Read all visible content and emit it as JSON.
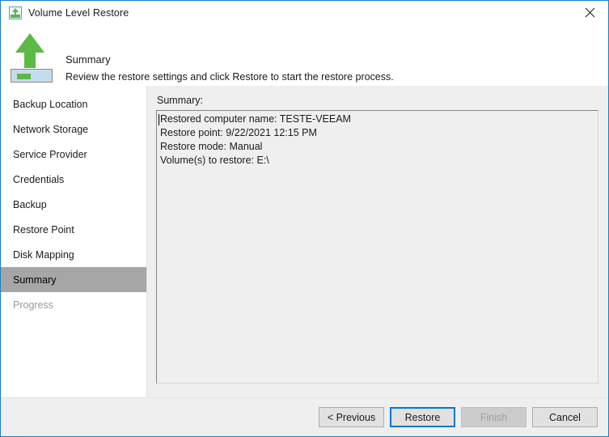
{
  "window": {
    "title": "Volume Level Restore",
    "title_icon": "volume-restore-icon",
    "close_icon": "close-icon",
    "accent_border_color": "#1a7ec2"
  },
  "header": {
    "icon": "green-up-arrow-volume-icon",
    "title": "Summary",
    "subtitle": "Review the restore settings and click Restore to start the restore process."
  },
  "sidebar": {
    "items": [
      {
        "label": "Backup Location",
        "state": "normal"
      },
      {
        "label": "Network Storage",
        "state": "normal"
      },
      {
        "label": "Service Provider",
        "state": "normal"
      },
      {
        "label": "Credentials",
        "state": "normal"
      },
      {
        "label": "Backup",
        "state": "normal"
      },
      {
        "label": "Restore Point",
        "state": "normal"
      },
      {
        "label": "Disk Mapping",
        "state": "normal"
      },
      {
        "label": "Summary",
        "state": "selected"
      },
      {
        "label": "Progress",
        "state": "disabled"
      }
    ],
    "selected_background": "#a6a6a6"
  },
  "content": {
    "summary_label": "Summary:",
    "summary_text": "Restored computer name: TESTE-VEEAM\nRestore point: 9/22/2021 12:15 PM\nRestore mode: Manual\nVolume(s) to restore: E:\\",
    "summary_lines": [
      "Restored computer name: TESTE-VEEAM",
      "Restore point: 9/22/2021 12:15 PM",
      "Restore mode: Manual",
      "Volume(s) to restore: E:\\"
    ]
  },
  "footer": {
    "buttons": [
      {
        "label": "< Previous",
        "state": "enabled"
      },
      {
        "label": "Restore",
        "state": "default-focused"
      },
      {
        "label": "Finish",
        "state": "disabled"
      },
      {
        "label": "Cancel",
        "state": "enabled"
      }
    ],
    "default_button_color": "#0078d7"
  }
}
